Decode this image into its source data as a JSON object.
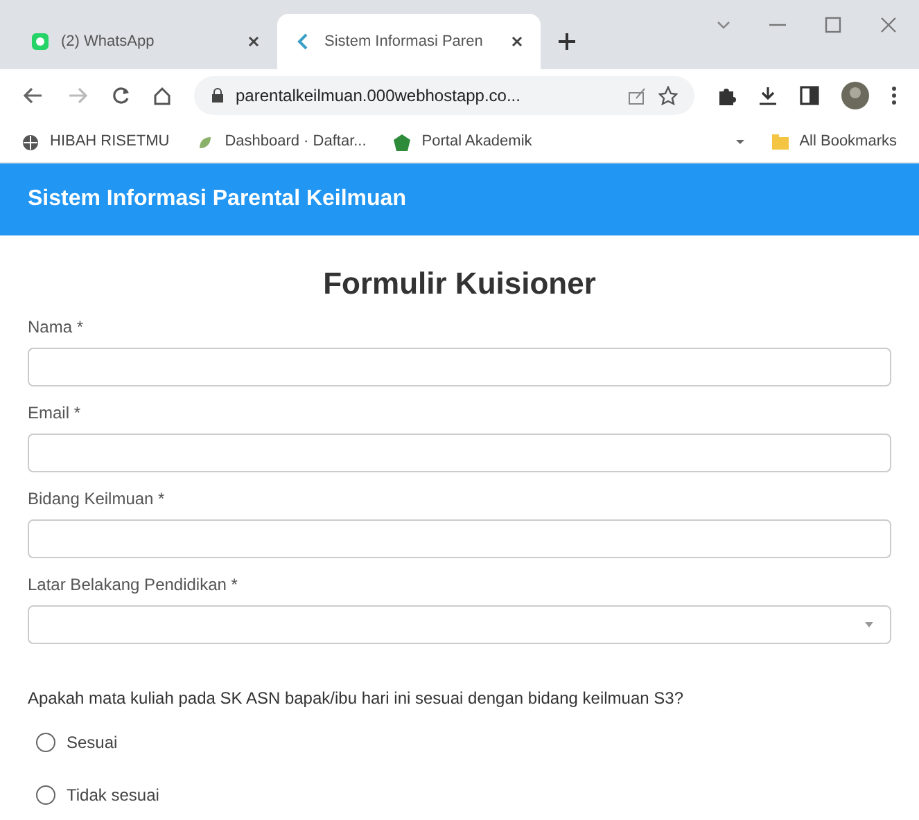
{
  "browser": {
    "tabs": [
      {
        "title": "(2) WhatsApp",
        "selected": false
      },
      {
        "title": "Sistem Informasi Paren",
        "selected": true
      }
    ],
    "url": "parentalkeilmuan.000webhostapp.co...",
    "bookmarks": [
      {
        "label": "HIBAH RISETMU"
      },
      {
        "label": "Dashboard · Daftar..."
      },
      {
        "label": "Portal Akademik"
      }
    ],
    "all_bookmarks": "All Bookmarks"
  },
  "header": {
    "title": "Sistem Informasi Parental Keilmuan"
  },
  "form": {
    "title": "Formulir Kuisioner",
    "fields": [
      {
        "kind": "text",
        "label": "Nama *"
      },
      {
        "kind": "text",
        "label": "Email *"
      },
      {
        "kind": "text",
        "label": "Bidang Keilmuan *"
      },
      {
        "kind": "select",
        "label": "Latar Belakang Pendidikan *"
      }
    ],
    "question": "Apakah mata kuliah pada SK ASN bapak/ibu hari ini sesuai dengan bidang keilmuan S3?",
    "options": [
      {
        "label": "Sesuai",
        "selected": false
      },
      {
        "label": "Tidak sesuai",
        "selected": false
      }
    ]
  }
}
